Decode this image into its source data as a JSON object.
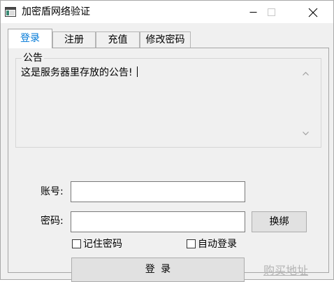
{
  "window": {
    "title": "加密盾网络验证"
  },
  "tabs": {
    "login": "登录",
    "register": "注册",
    "recharge": "充值",
    "change_password": "修改密码"
  },
  "notice": {
    "legend": "公告",
    "text": "这是服务器里存放的公告!"
  },
  "form": {
    "account_label": "账号:",
    "account_value": "",
    "password_label": "密码:",
    "password_value": "",
    "unbind_label": "换绑",
    "remember_label": "记住密码",
    "remember_checked": false,
    "autologin_label": "自动登录",
    "autologin_checked": false,
    "login_label": "登录"
  },
  "links": {
    "buy_address": "购买地址"
  },
  "icons": {
    "app": "app-window-icon",
    "minimize": "minimize-icon",
    "maximize": "maximize-icon",
    "close": "close-icon",
    "scroll_up": "chevron-up-icon",
    "scroll_down": "chevron-down-icon"
  },
  "colors": {
    "active_tab_text": "#0078d7",
    "link_text": "#b3b3b3",
    "client_background": "#f0f0f0"
  }
}
